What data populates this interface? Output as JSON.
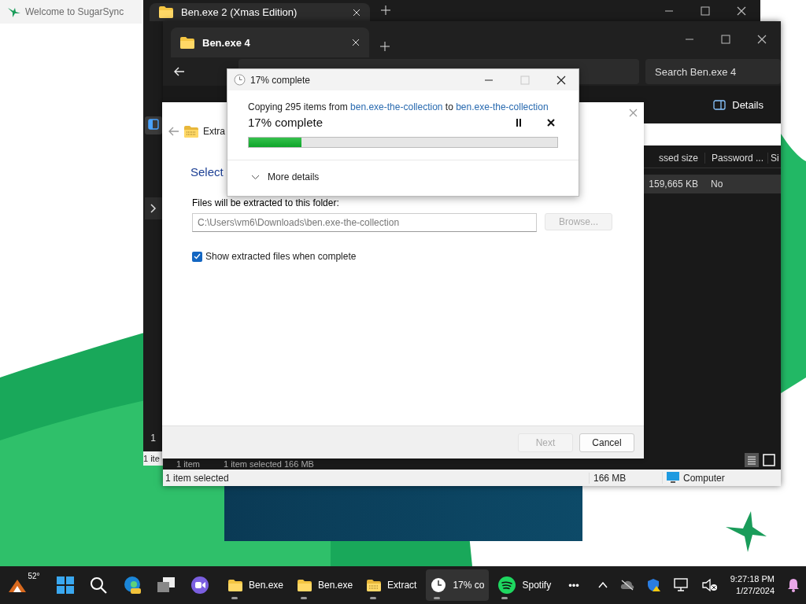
{
  "desktop": {
    "banner": {
      "title": "Welcome to SugarSync"
    }
  },
  "back_window": {
    "tab": {
      "title": "Ben.exe 2 (Xmas Edition)"
    },
    "row_number": "1",
    "status": "1 ite"
  },
  "explorer": {
    "tab": {
      "title": "Ben.exe 4"
    },
    "search": {
      "placeholder": "Search Ben.exe 4"
    },
    "details_button": "Details",
    "columns": [
      "ssed size",
      "Password ...",
      "Si"
    ],
    "rows": [
      {
        "cells": [
          "159,665 KB",
          "No"
        ],
        "selected": true
      }
    ],
    "status_top": [
      "1 item",
      "1 item selected  166 MB"
    ],
    "status_bar": {
      "selection": "1 item selected",
      "size": "166 MB",
      "zone": "Computer"
    }
  },
  "extract_wizard": {
    "title": "Extra",
    "heading": "Select",
    "folder_label": "Files will be extracted to this folder:",
    "folder_path": "C:\\Users\\vm6\\Downloads\\ben.exe-the-collection",
    "browse": {
      "label": "Browse...",
      "disabled": true
    },
    "show_files": {
      "label": "Show extracted files when complete",
      "checked": true
    },
    "buttons": [
      {
        "label": "Next",
        "disabled": true
      },
      {
        "label": "Cancel",
        "disabled": false
      }
    ]
  },
  "copy_dialog": {
    "title": "17% complete",
    "message": {
      "prefix": "Copying 295 items from",
      "source": "ben.exe-the-collection",
      "joiner": "to",
      "destination": "ben.exe-the-collection"
    },
    "status": "17% complete",
    "level": 0.17,
    "more_details": "More details"
  },
  "taskbar": {
    "weather": "52°",
    "apps": [
      {
        "kind": "folder",
        "label": "Ben.exe",
        "selected": false
      },
      {
        "kind": "folder",
        "label": "Ben.exe",
        "selected": false
      },
      {
        "kind": "zip",
        "label": "Extract",
        "selected": false
      },
      {
        "kind": "clock",
        "label": "17% co",
        "selected": true
      },
      {
        "kind": "spotify",
        "label": "Spotify",
        "selected": false
      }
    ],
    "overflow": "•••",
    "clock": {
      "time": "9:27:18 PM",
      "date": "1/27/2024"
    }
  }
}
